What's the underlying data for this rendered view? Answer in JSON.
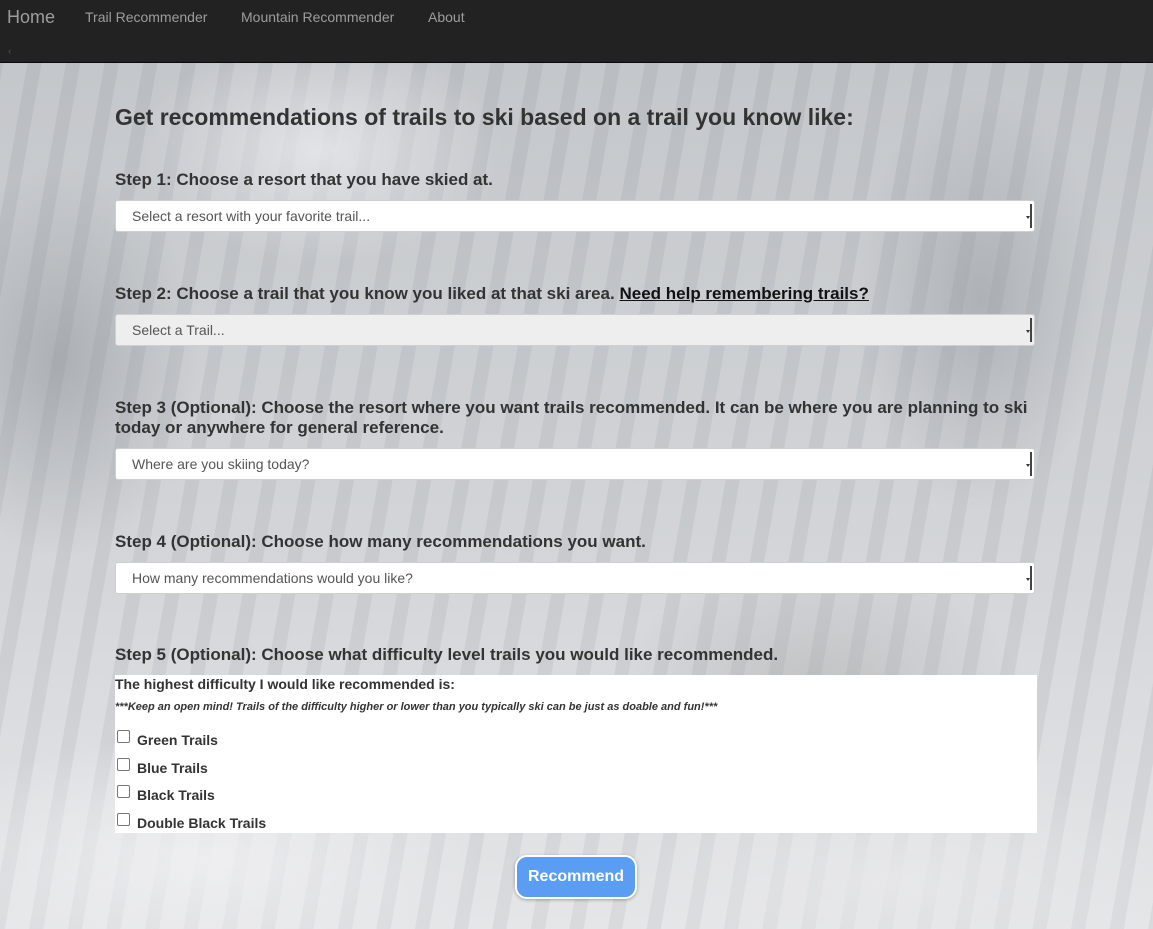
{
  "navbar": {
    "brand": "Home",
    "items": [
      "Trail Recommender",
      "Mountain Recommender",
      "About"
    ]
  },
  "main": {
    "title": "Get recommendations of trails to ski based on a trail you know like:",
    "step1": {
      "label": "Step 1: Choose a resort that you have skied at.",
      "select_value": "Select a resort with your favorite trail..."
    },
    "step2": {
      "label": "Step 2: Choose a trail that you know you liked at that ski area.",
      "help_link": "Need help remembering trails?",
      "select_value": "Select a Trail..."
    },
    "step3": {
      "label": "Step 3 (Optional): Choose the resort where you want trails recommended. It can be where you are planning to ski today or anywhere for general reference.",
      "select_value": "Where are you skiing today?"
    },
    "step4": {
      "label": "Step 4 (Optional): Choose how many recommendations you want.",
      "select_value": "How many recommendations would you like?"
    },
    "step5": {
      "label": "Step 5 (Optional): Choose what difficulty level trails you would like recommended.",
      "heading": "The highest difficulty I would like recommended is:",
      "note": "***Keep an open mind! Trails of the difficulty higher or lower than you typically ski can be just as doable and fun!***",
      "options": [
        {
          "label": "Green Trails",
          "checked": false
        },
        {
          "label": "Blue Trails",
          "checked": false
        },
        {
          "label": "Black Trails",
          "checked": false
        },
        {
          "label": "Double Black Trails",
          "checked": false
        }
      ]
    },
    "submit_label": "Recommend"
  },
  "colors": {
    "navbar": "#222222",
    "button": "#5b9df2"
  }
}
